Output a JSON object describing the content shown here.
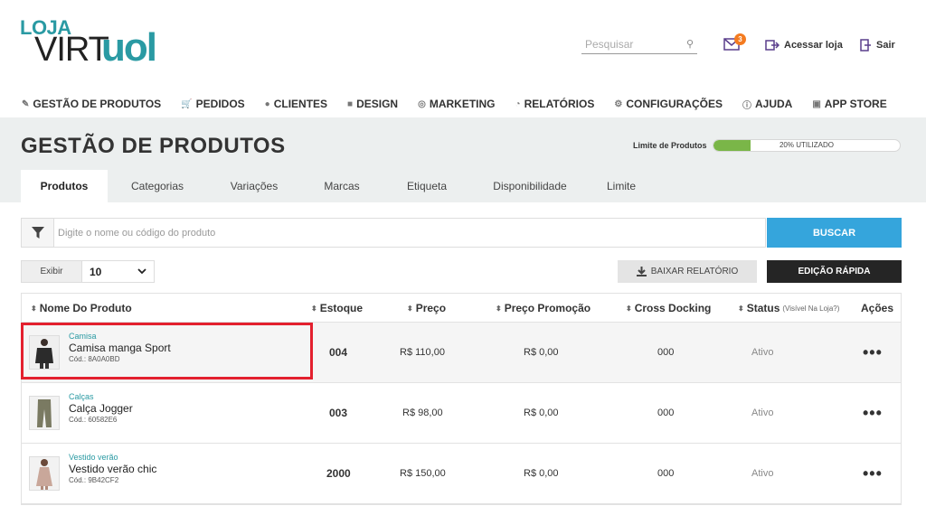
{
  "header": {
    "logo": {
      "top": "LOJA",
      "left": "VIRT",
      "right": "uol"
    },
    "search_placeholder": "Pesquisar",
    "mail_count": "3",
    "acessar_loja": "Acessar loja",
    "sair": "Sair"
  },
  "nav": [
    {
      "label": "GESTÃO DE PRODUTOS",
      "icon": "edit-icon"
    },
    {
      "label": "PEDIDOS",
      "icon": "cart-icon"
    },
    {
      "label": "CLIENTES",
      "icon": "user-icon"
    },
    {
      "label": "DESIGN",
      "icon": "design-icon"
    },
    {
      "label": "MARKETING",
      "icon": "target-icon"
    },
    {
      "label": "RELATÓRIOS",
      "icon": "pie-chart-icon"
    },
    {
      "label": "CONFIGURAÇÕES",
      "icon": "gears-icon"
    },
    {
      "label": "AJUDA",
      "icon": "help-icon"
    },
    {
      "label": "APP STORE",
      "icon": "store-icon"
    }
  ],
  "page": {
    "title": "GESTÃO DE PRODUTOS",
    "limite_label": "Limite de Produtos",
    "limite_text": "20% UTILIZADO",
    "limite_fraction": 0.2,
    "limite_color": "#7ab648"
  },
  "tabs": [
    {
      "label": "Produtos",
      "active": true
    },
    {
      "label": "Categorias",
      "active": false
    },
    {
      "label": "Variações",
      "active": false
    },
    {
      "label": "Marcas",
      "active": false
    },
    {
      "label": "Etiqueta",
      "active": false
    },
    {
      "label": "Disponibilidade",
      "active": false
    },
    {
      "label": "Limite",
      "active": false
    }
  ],
  "filter": {
    "placeholder": "Digite o nome ou código do produto",
    "buscar": "BUSCAR"
  },
  "toolbar": {
    "exibir_label": "Exibir",
    "exibir_value": "10",
    "baixar_relatorio": "BAIXAR RELATÓRIO",
    "edicao_rapida": "EDIÇÃO RÁPIDA"
  },
  "table": {
    "columns": {
      "nome": "Nome Do Produto",
      "estoque": "Estoque",
      "preco": "Preço",
      "preco_promocao": "Preço Promoção",
      "cross_docking": "Cross Docking",
      "status": "Status",
      "status_sub": "(Visível Na Loja?)",
      "acoes": "Ações"
    },
    "rows": [
      {
        "categoria": "Camisa",
        "nome": "Camisa manga Sport",
        "codigo": "Cód.: 8A0A0BD",
        "estoque": "004",
        "preco": "R$ 110,00",
        "preco_promocao": "R$ 0,00",
        "cross_docking": "000",
        "status": "Ativo",
        "acoes": "•••"
      },
      {
        "categoria": "Calças",
        "nome": "Calça Jogger",
        "codigo": "Cód.: 60582E6",
        "estoque": "003",
        "preco": "R$ 98,00",
        "preco_promocao": "R$ 0,00",
        "cross_docking": "000",
        "status": "Ativo",
        "acoes": "•••"
      },
      {
        "categoria": "Vestido verão",
        "nome": "Vestido verão chic",
        "codigo": "Cód.: 9B42CF2",
        "estoque": "2000",
        "preco": "R$ 150,00",
        "preco_promocao": "R$ 0,00",
        "cross_docking": "000",
        "status": "Ativo",
        "acoes": "•••"
      }
    ]
  },
  "colors": {
    "brand": "#2a9aa3",
    "buscar_bg": "#35a5dc",
    "highlight_border": "#e3202e",
    "badge": "#f47b20"
  }
}
